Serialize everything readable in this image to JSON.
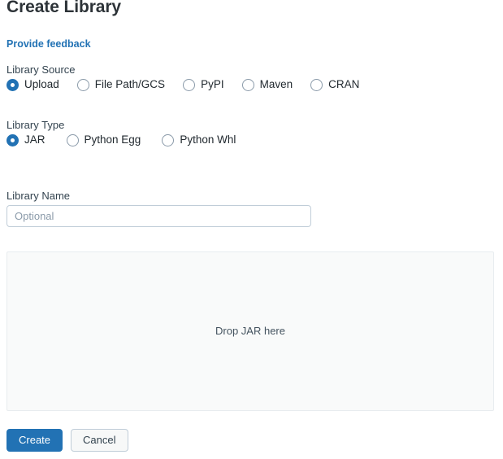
{
  "page": {
    "title": "Create Library",
    "feedback_link": "Provide feedback"
  },
  "library_source": {
    "label": "Library Source",
    "selected": "Upload",
    "options": [
      {
        "label": "Upload",
        "checked": true
      },
      {
        "label": "File Path/GCS",
        "checked": false
      },
      {
        "label": "PyPI",
        "checked": false
      },
      {
        "label": "Maven",
        "checked": false
      },
      {
        "label": "CRAN",
        "checked": false
      }
    ]
  },
  "library_type": {
    "label": "Library Type",
    "selected": "JAR",
    "options": [
      {
        "label": "JAR",
        "checked": true
      },
      {
        "label": "Python Egg",
        "checked": false
      },
      {
        "label": "Python Whl",
        "checked": false
      }
    ]
  },
  "library_name": {
    "label": "Library Name",
    "value": "",
    "placeholder": "Optional"
  },
  "dropzone": {
    "text": "Drop JAR here"
  },
  "buttons": {
    "create": "Create",
    "cancel": "Cancel"
  },
  "colors": {
    "accent": "#2272b4",
    "link": "#2272b4",
    "text": "#1f272d",
    "border": "#c0cdd8",
    "dropzone_bg": "#f9fafa"
  }
}
